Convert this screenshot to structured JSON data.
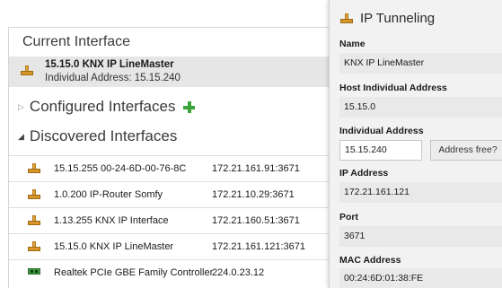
{
  "left": {
    "current_interface": {
      "title": "Current Interface",
      "name": "15.15.0 KNX IP LineMaster",
      "individual_address": "Individual Address: 15.15.240",
      "icon": "connector-icon"
    },
    "configured": {
      "title": "Configured Interfaces",
      "expanded": false,
      "add_icon": "plus-icon",
      "accent": "#3aa33a"
    },
    "discovered": {
      "title": "Discovered Interfaces",
      "expanded": true,
      "rows": [
        {
          "name": "15.15.255 00-24-6D-00-76-8C",
          "address": "172.21.161.91:3671",
          "icon": "connector-icon"
        },
        {
          "name": "1.0.200 IP-Router Somfy",
          "address": "172.21.10.29:3671",
          "icon": "connector-icon"
        },
        {
          "name": "1.13.255 KNX IP Interface",
          "address": "172.21.160.51:3671",
          "icon": "connector-icon"
        },
        {
          "name": "15.15.0 KNX IP LineMaster",
          "address": "172.21.161.121:3671",
          "icon": "connector-icon"
        },
        {
          "name": "Realtek PCIe GBE Family Controller",
          "address": "224.0.23.12",
          "icon": "network-card-icon"
        }
      ]
    }
  },
  "right": {
    "title": "IP Tunneling",
    "icon": "connector-icon",
    "name_label": "Name",
    "name_value": "KNX IP LineMaster",
    "host_label": "Host Individual Address",
    "host_value": "15.15.0",
    "ind_label": "Individual Address",
    "ind_value": "15.15.240",
    "address_free_button": "Address free?",
    "ip_label": "IP Address",
    "ip_value": "172.21.161.121",
    "port_label": "Port",
    "port_value": "3671",
    "mac_label": "MAC Address",
    "mac_value": "00:24:6D:01:38:FE"
  }
}
